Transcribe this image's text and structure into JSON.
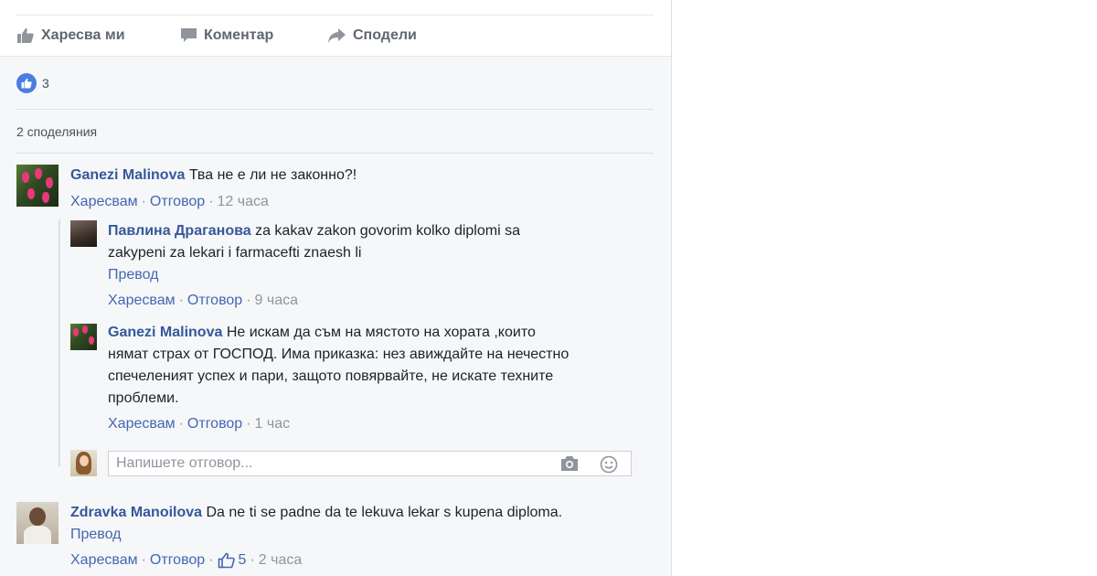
{
  "actions": {
    "like_label": "Харесва ми",
    "comment_label": "Коментар",
    "share_label": "Сподели"
  },
  "reactions": {
    "count": "3"
  },
  "shares_label": "2 споделяния",
  "comments": [
    {
      "author": "Ganezi Malinova",
      "text": "Тва не е ли не законно?!",
      "like": "Харесвам",
      "reply": "Отговор",
      "time": "12 часа",
      "replies": [
        {
          "author": "Павлина Драганова",
          "text_line1": "za kakav zakon govorim kolko diplomi sa",
          "text_line2": "zakypeni za lekari i farmacefti znaesh li",
          "translate": "Превод",
          "like": "Харесвам",
          "reply": "Отговор",
          "time": "9 часа"
        },
        {
          "author": "Ganezi Malinova",
          "text_line1": "Не искам да съм на мястото на хората ,които",
          "text_line2": "нямат страх от ГОСПОД. Има приказка: нез авиждайте на нечестно",
          "text_line3": "спечеленият успех и пари, защото повярвайте, не искате техните",
          "text_line4": "проблеми.",
          "like": "Харесвам",
          "reply": "Отговор",
          "time": "1 час"
        }
      ]
    },
    {
      "author": "Zdravka Manoilova",
      "text": "Da ne ti se padne da te lekuva lekar s kupena diploma.",
      "translate": "Превод",
      "like": "Харесвам",
      "reply": "Отговор",
      "like_count": "5",
      "time": "2 часа"
    }
  ],
  "reply_box": {
    "placeholder": "Напишете отговор..."
  },
  "icons": {
    "like": "thumbs-up-icon",
    "comment": "speech-bubble-icon",
    "share": "share-arrow-icon",
    "camera": "camera-icon",
    "emoji": "smiley-icon"
  },
  "colors": {
    "link": "#365899",
    "like_blue": "#4a7de2",
    "meta_gray": "#90949c"
  }
}
